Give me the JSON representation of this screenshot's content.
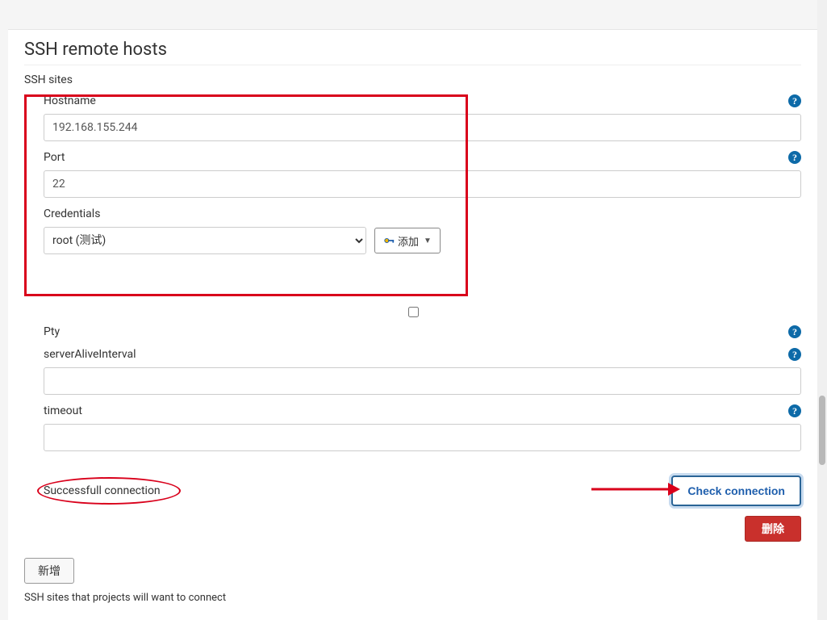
{
  "section": {
    "title": "SSH remote hosts",
    "sites_label": "SSH sites",
    "footnote": "SSH sites that projects will want to connect"
  },
  "fields": {
    "hostname": {
      "label": "Hostname",
      "value": "192.168.155.244"
    },
    "port": {
      "label": "Port",
      "value": "22"
    },
    "credentials": {
      "label": "Credentials",
      "selected": "root (测试)",
      "add_label": "添加"
    },
    "pty": {
      "label": "Pty"
    },
    "serverAliveInterval": {
      "label": "serverAliveInterval",
      "value": ""
    },
    "timeout": {
      "label": "timeout",
      "value": ""
    }
  },
  "status": {
    "message": "Successfull connection"
  },
  "buttons": {
    "check": "Check connection",
    "delete": "删除",
    "add_new": "新增"
  }
}
